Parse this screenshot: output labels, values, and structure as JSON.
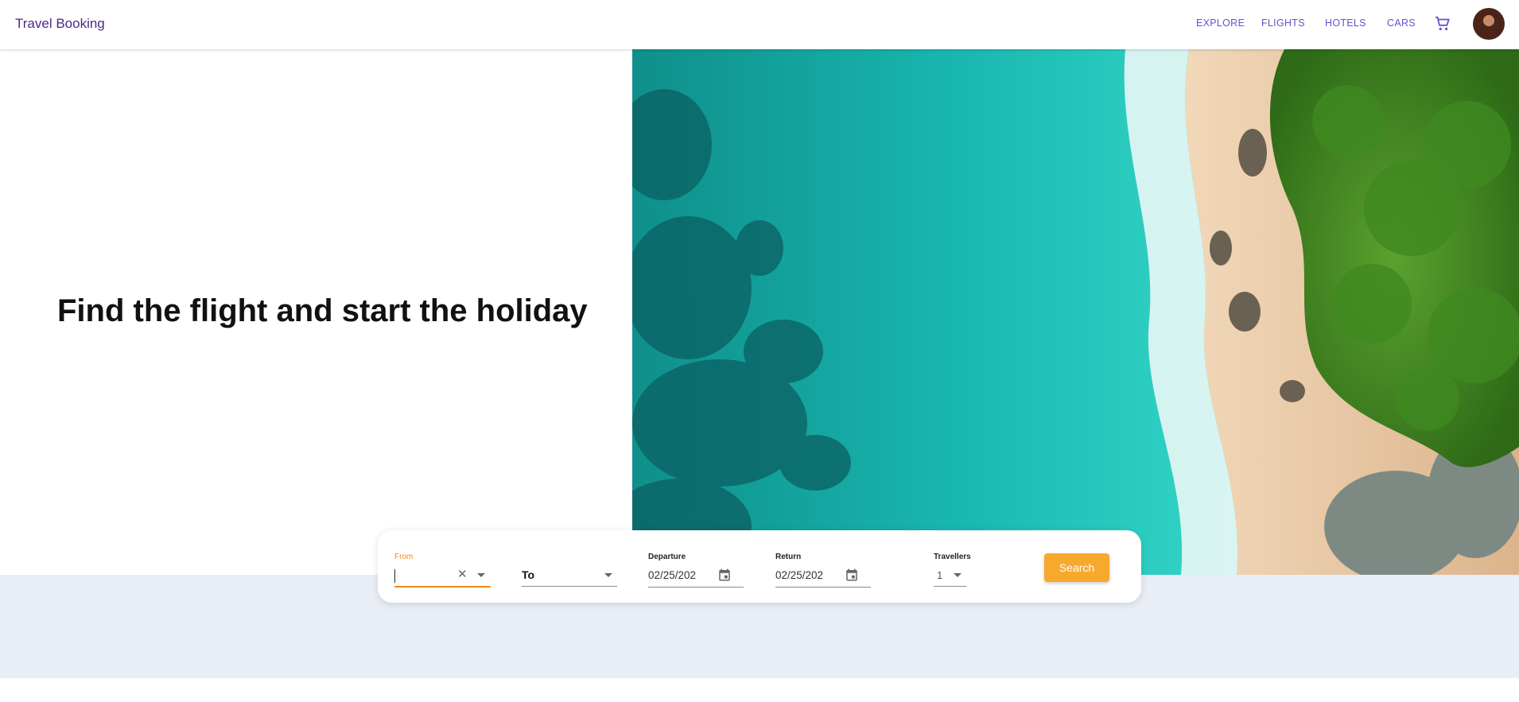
{
  "header": {
    "brand": "Travel Booking",
    "nav": [
      "EXPLORE",
      "FLIGHTS",
      "HOTELS",
      "CARS"
    ],
    "cart_icon": "cart-icon",
    "avatar_icon": "user-avatar"
  },
  "hero": {
    "title": "Find the flight and start the holiday",
    "image": "aerial-beach-photo"
  },
  "search": {
    "from": {
      "label": "From",
      "value": ""
    },
    "to": {
      "label": "To",
      "value": ""
    },
    "departure": {
      "label": "Departure",
      "value": "02/25/202"
    },
    "return": {
      "label": "Return",
      "value": "02/25/202"
    },
    "travellers": {
      "label": "Travellers",
      "value": "1"
    },
    "button": "Search"
  },
  "colors": {
    "brand": "#4a2a8a",
    "nav": "#6a4fcf",
    "accent": "#f6a92c",
    "focus": "#f28c18",
    "band": "#e9edf5"
  }
}
